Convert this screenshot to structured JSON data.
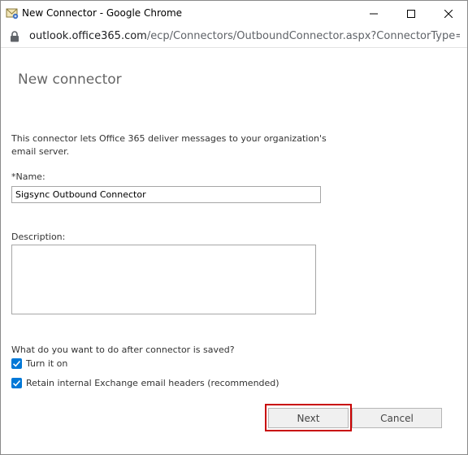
{
  "window": {
    "title": "New Connector - Google Chrome",
    "url_host": "outlook.office365.com",
    "url_path": "/ecp/Connectors/OutboundConnector.aspx?ConnectorType=..."
  },
  "page": {
    "title": "New connector",
    "intro": "This connector lets Office 365 deliver messages to your organization's email server."
  },
  "form": {
    "name_label": "*Name:",
    "name_value": "Sigsync Outbound Connector",
    "description_label": "Description:",
    "description_value": "",
    "question": "What do you want to do after connector is saved?",
    "options": [
      {
        "label": "Turn it on",
        "checked": true
      },
      {
        "label": "Retain internal Exchange email headers (recommended)",
        "checked": true
      }
    ]
  },
  "buttons": {
    "next": "Next",
    "cancel": "Cancel"
  },
  "colors": {
    "checkbox": "#0078d7",
    "highlight": "#c80000"
  },
  "icons": [
    "mail-app-icon",
    "minimize-icon",
    "maximize-icon",
    "close-icon",
    "lock-icon",
    "check-icon"
  ]
}
